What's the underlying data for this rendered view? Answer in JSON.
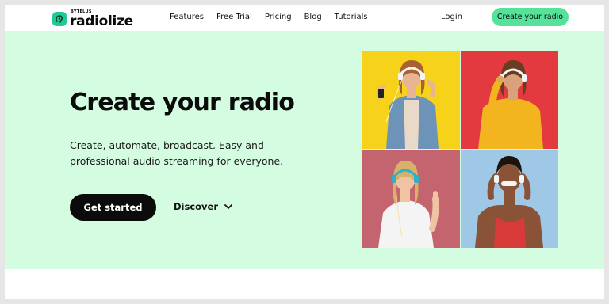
{
  "brand": {
    "super": "BYTELUS",
    "name": "radiolize",
    "accent": "#56e29a",
    "mark_color": "#20c997"
  },
  "nav": {
    "items": [
      "Features",
      "Free Trial",
      "Pricing",
      "Blog",
      "Tutorials"
    ],
    "login": "Login",
    "cta": "Create your radio"
  },
  "hero": {
    "title": "Create your radio",
    "subtitle": "Create, automate, broadcast. Easy and professional audio streaming for everyone.",
    "primary_button": "Get started",
    "secondary_button": "Discover",
    "background": "#d4fce0"
  },
  "gallery": {
    "icons": [
      "person-headphones-photo",
      "person-headphones-photo",
      "person-headphones-photo",
      "person-headphones-photo"
    ],
    "backgrounds": [
      "#f6d21a",
      "#e23a3f",
      "#c4646e",
      "#9ec8e6"
    ]
  }
}
